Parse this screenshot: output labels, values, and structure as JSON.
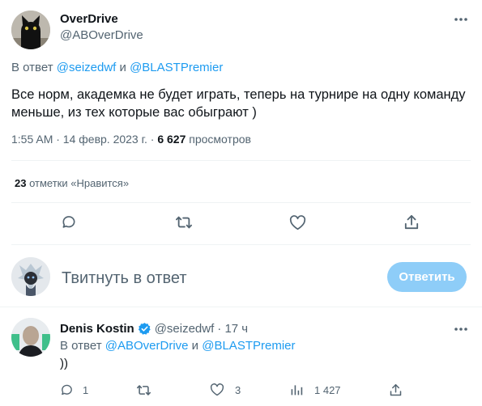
{
  "main_tweet": {
    "display_name": "OverDrive",
    "handle": "@ABOverDrive",
    "reply_prefix": "В ответ",
    "reply_to_1": "@seizedwf",
    "reply_and": "и",
    "reply_to_2": "@BLASTPremier",
    "text_line1": "Все норм, академка не будет играть, теперь на турнире на одну команду",
    "text_line2": "меньше, из тех которые вас обыгрaют )",
    "timestamp": "1:55 AM · 14 февр. 2023 г. ·",
    "views_count": "6 627",
    "views_label": "просмотров",
    "likes_count": "23",
    "likes_label": "отметки «Нравится»"
  },
  "compose": {
    "placeholder": "Твитнуть в ответ",
    "button_label": "Ответить"
  },
  "reply_tweet": {
    "display_name": "Denis Kostin",
    "handle": "@seizedwf",
    "time": "· 17 ч",
    "reply_prefix": "В ответ",
    "reply_to_1": "@ABOverDrive",
    "reply_and": "и",
    "reply_to_2": "@BLASTPremier",
    "text": "))",
    "reply_count": "1",
    "like_count": "3",
    "views_count": "1 427"
  },
  "colors": {
    "accent": "#1d9bf0",
    "verified": "#1d9bf0",
    "muted_text": "#536471",
    "divider": "#eff3f4"
  },
  "icons": [
    "more-icon",
    "reply-icon",
    "retweet-icon",
    "like-icon",
    "share-icon",
    "views-icon",
    "verified-badge-icon"
  ]
}
